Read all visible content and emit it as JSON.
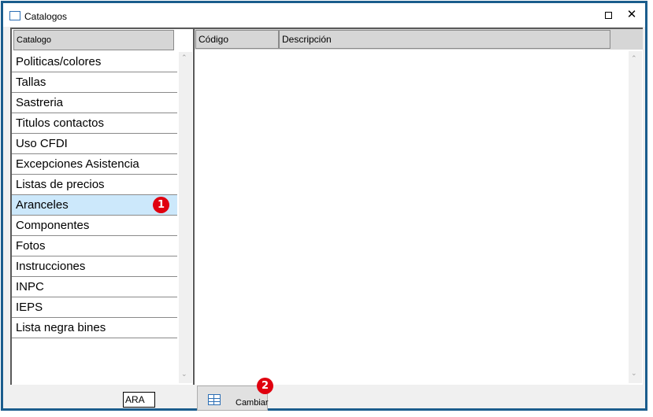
{
  "window": {
    "title": "Catalogos",
    "close_glyph": "✕"
  },
  "left": {
    "header": "Catalogo",
    "items": [
      {
        "label": "Politicas/colores"
      },
      {
        "label": "Tallas"
      },
      {
        "label": "Sastreria"
      },
      {
        "label": "Titulos contactos"
      },
      {
        "label": "Uso CFDI"
      },
      {
        "label": "Excepciones Asistencia"
      },
      {
        "label": "Listas de precios"
      },
      {
        "label": "Aranceles",
        "selected": true,
        "badge": "1"
      },
      {
        "label": "Componentes"
      },
      {
        "label": "Fotos"
      },
      {
        "label": "Instrucciones"
      },
      {
        "label": "INPC"
      },
      {
        "label": "IEPS"
      },
      {
        "label": "Lista negra bines"
      }
    ]
  },
  "right": {
    "columns": [
      "Código",
      "Descripción"
    ]
  },
  "bottom": {
    "code_value": "ARA",
    "change_label": "Cambiar",
    "change_badge": "2"
  },
  "colors": {
    "window_border": "#1b5d8d",
    "selection": "#cce8fb",
    "badge": "#e0000f"
  }
}
